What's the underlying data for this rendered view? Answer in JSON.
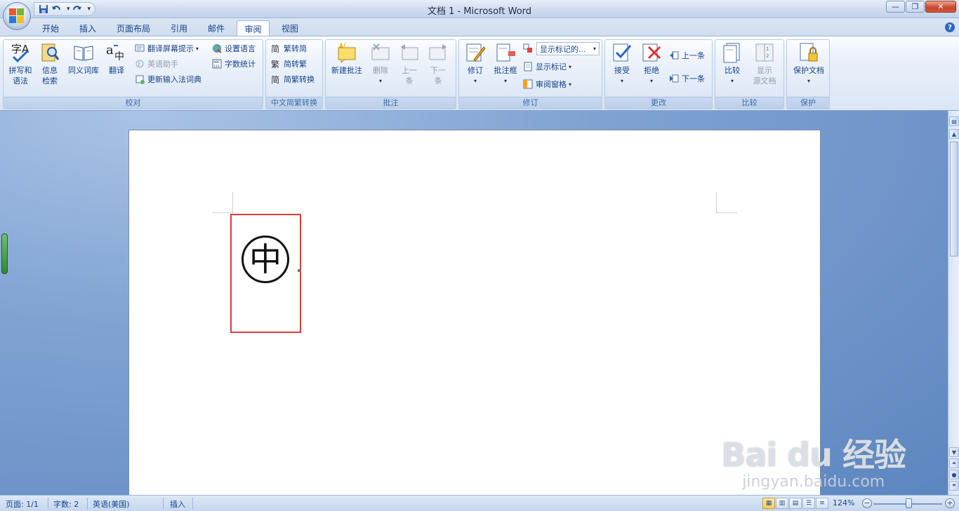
{
  "window": {
    "title": "文档 1 - Microsoft Word",
    "buttons": {
      "minimize": "—",
      "maximize": "❐",
      "close": "✕"
    }
  },
  "qat": {
    "save_icon": "save-icon",
    "undo_icon": "undo-icon",
    "redo_icon": "redo-icon"
  },
  "tabs": [
    {
      "label": "开始"
    },
    {
      "label": "插入"
    },
    {
      "label": "页面布局"
    },
    {
      "label": "引用"
    },
    {
      "label": "邮件"
    },
    {
      "label": "审阅",
      "active": true
    },
    {
      "label": "视图"
    }
  ],
  "help": "?",
  "ribbon": {
    "proofing": {
      "label": "校对",
      "spelling": "拼写和\n语法",
      "spelling_l1": "拼写和",
      "spelling_l2": "语法",
      "research_l1": "信息",
      "research_l2": "检索",
      "thesaurus": "同义词库",
      "translate": "翻译",
      "screentip": "翻译屏幕提示",
      "english_assistant": "英语助手",
      "update_ime": "更新输入法词典",
      "set_language": "设置语言",
      "word_count": "字数统计"
    },
    "chinese_conversion": {
      "label": "中文简繁转换",
      "trad_to_simp": "繁转简",
      "simp_to_trad": "简转繁",
      "convert": "简繁转换"
    },
    "comments": {
      "label": "批注",
      "new_comment": "新建批注",
      "delete": "删除",
      "prev_l1": "上一",
      "prev_l2": "条",
      "next_l1": "下一",
      "next_l2": "条"
    },
    "tracking": {
      "label": "修订",
      "track_changes": "修订",
      "balloons": "批注框",
      "display_for_review": "显示标记的...",
      "show_markup": "显示标记",
      "reviewing_pane": "审阅窗格"
    },
    "changes": {
      "label": "更改",
      "accept": "接受",
      "reject": "拒绝",
      "previous": "上一条",
      "next": "下一条"
    },
    "compare": {
      "label": "比较",
      "compare": "比较",
      "show_source_l1": "显示",
      "show_source_l2": "源文档"
    },
    "protect": {
      "label": "保护",
      "protect_document": "保护文档"
    }
  },
  "document": {
    "enclosed_character": "中"
  },
  "watermark": {
    "brand": "Bai du 经验",
    "url": "jingyan.baidu.com"
  },
  "status": {
    "page": "页面: 1/1",
    "words": "字数: 2",
    "language": "英语(美国)",
    "mode": "插入",
    "zoom": "124%"
  },
  "colors": {
    "ribbon_text": "#15428b",
    "selection_border": "#e03a3a",
    "page_background": "#ffffff"
  }
}
